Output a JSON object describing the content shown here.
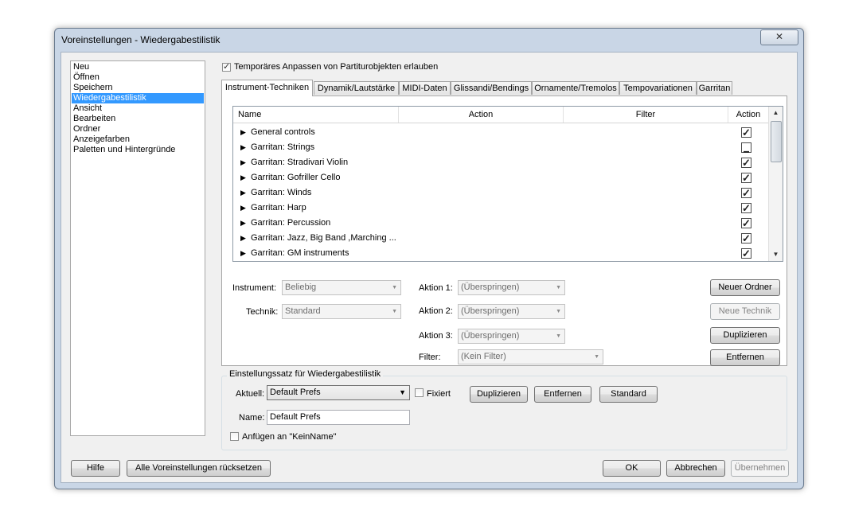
{
  "window": {
    "title": "Voreinstellungen - Wiedergabestilistik",
    "close_glyph": "✕"
  },
  "categories": [
    {
      "label": "Neu"
    },
    {
      "label": "Öffnen"
    },
    {
      "label": "Speichern"
    },
    {
      "label": "Wiedergabestilistik",
      "selected": true
    },
    {
      "label": "Ansicht"
    },
    {
      "label": "Bearbeiten"
    },
    {
      "label": "Ordner"
    },
    {
      "label": "Anzeigefarben"
    },
    {
      "label": "Paletten und Hintergründe"
    }
  ],
  "temp_adjust": {
    "label": "Temporäres Anpassen von Partiturobjekten erlauben",
    "checked": true
  },
  "tabs": [
    {
      "label": "Instrument-Techniken",
      "active": true
    },
    {
      "label": "Dynamik/Lautstärke"
    },
    {
      "label": "MIDI-Daten"
    },
    {
      "label": "Glissandi/Bendings"
    },
    {
      "label": "Ornamente/Tremolos"
    },
    {
      "label": "Tempovariationen"
    },
    {
      "label": "Garritan"
    }
  ],
  "grid": {
    "columns": [
      "Name",
      "Action",
      "Filter",
      "Action"
    ],
    "rows": [
      {
        "name": "General controls",
        "state": "checked"
      },
      {
        "name": "Garritan: Strings",
        "state": "mixed"
      },
      {
        "name": "Garritan: Stradivari Violin",
        "state": "checked"
      },
      {
        "name": "Garritan: Gofriller Cello",
        "state": "checked"
      },
      {
        "name": "Garritan: Winds",
        "state": "checked"
      },
      {
        "name": "Garritan: Harp",
        "state": "checked"
      },
      {
        "name": "Garritan: Percussion",
        "state": "checked"
      },
      {
        "name": "Garritan: Jazz, Big Band ,Marching ...",
        "state": "checked"
      },
      {
        "name": "Garritan: GM instruments",
        "state": "checked"
      }
    ]
  },
  "fields": {
    "instrument_label": "Instrument:",
    "instrument_value": "Beliebig",
    "technik_label": "Technik:",
    "technik_value": "Standard",
    "aktion1_label": "Aktion 1:",
    "aktion1_value": "(Überspringen)",
    "aktion2_label": "Aktion 2:",
    "aktion2_value": "(Überspringen)",
    "aktion3_label": "Aktion 3:",
    "aktion3_value": "(Überspringen)",
    "filter_label": "Filter:",
    "filter_value": "(Kein Filter)"
  },
  "side_buttons": {
    "neuer_ordner": "Neuer Ordner",
    "neue_technik": "Neue Technik",
    "duplizieren": "Duplizieren",
    "entfernen": "Entfernen"
  },
  "settings_group": {
    "title": "Einstellungssatz für Wiedergabestilistik",
    "aktuell_label": "Aktuell:",
    "aktuell_value": "Default Prefs",
    "fixiert_label": "Fixiert",
    "fixiert_checked": false,
    "duplizieren": "Duplizieren",
    "entfernen": "Entfernen",
    "standard": "Standard",
    "name_label": "Name:",
    "name_value": "Default Prefs",
    "append_label": "Anfügen an \"KeinName\"",
    "append_checked": false
  },
  "footer": {
    "hilfe": "Hilfe",
    "reset_all": "Alle Voreinstellungen rücksetzen",
    "ok": "OK",
    "abbrechen": "Abbrechen",
    "uebernehmen": "Übernehmen"
  },
  "colors": {
    "selection": "#3399ff",
    "window_frame": "#c9d6e6",
    "dialog_bg": "#f0f0f0"
  }
}
